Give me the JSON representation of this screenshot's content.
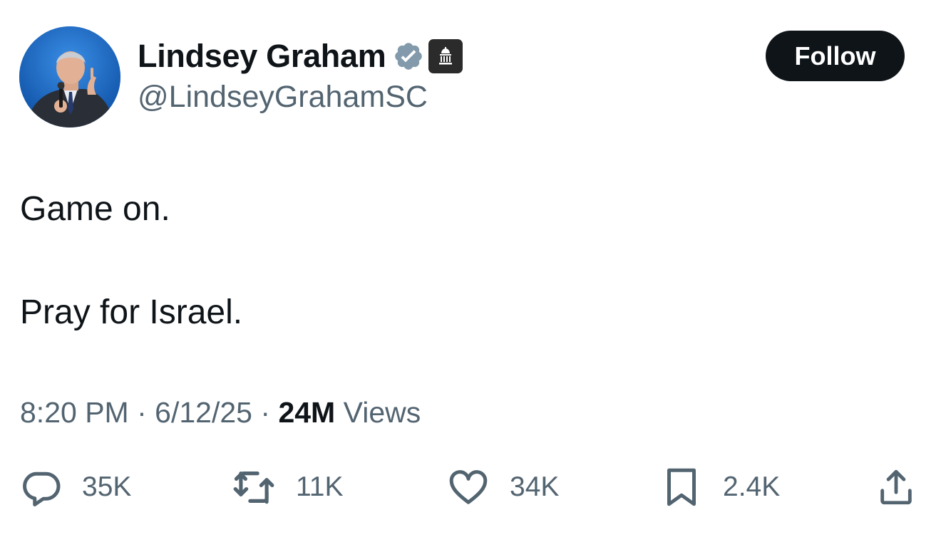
{
  "author": {
    "display_name": "Lindsey Graham",
    "handle": "@LindseyGrahamSC",
    "verified_icon": "verified-badge-icon",
    "affiliation_icon": "government-building-icon"
  },
  "follow_button": {
    "label": "Follow"
  },
  "tweet": {
    "lines": [
      "Game on.",
      "Pray for Israel."
    ]
  },
  "meta": {
    "time": "8:20 PM",
    "separator": "·",
    "date": "6/12/25",
    "views_count": "24M",
    "views_label": "Views"
  },
  "actions": {
    "reply": {
      "icon": "reply-icon",
      "count": "35K"
    },
    "repost": {
      "icon": "repost-icon",
      "count": "11K"
    },
    "like": {
      "icon": "heart-icon",
      "count": "34K"
    },
    "bookmark": {
      "icon": "bookmark-icon",
      "count": "2.4K"
    },
    "share": {
      "icon": "share-icon"
    }
  },
  "colors": {
    "text_primary": "#0f1419",
    "text_secondary": "#536471",
    "verified_badge": "#829aab",
    "follow_bg": "#0f1419",
    "avatar_bg": "#1d6fd0"
  }
}
